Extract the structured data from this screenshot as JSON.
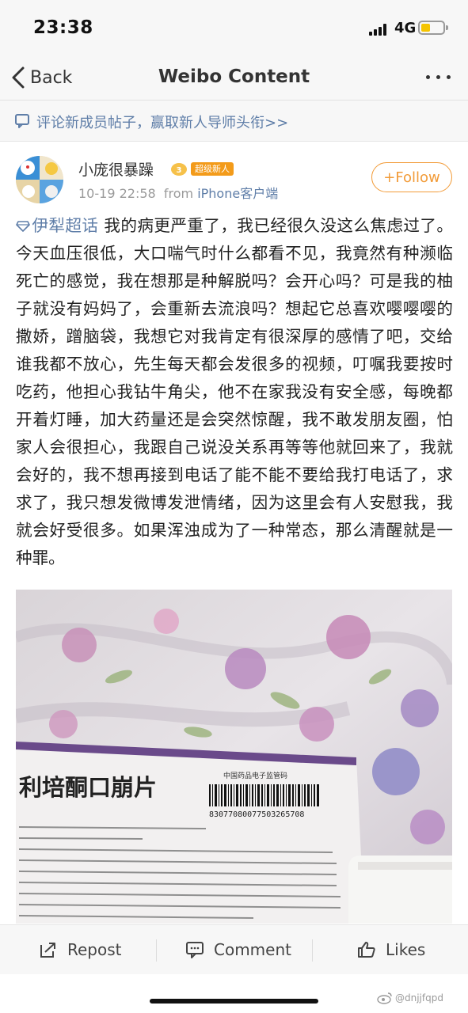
{
  "status_bar": {
    "time": "23:38",
    "network": "4G"
  },
  "nav": {
    "back_label": "Back",
    "title": "Weibo Content"
  },
  "promo": {
    "text": "评论新成员帖子，赢取新人导师头衔>>"
  },
  "post": {
    "author": "小庞很暴躁",
    "badge": "超级新人",
    "date": "10-19 22:58",
    "from_label": "from",
    "source": "iPhone客户端",
    "follow_label": "+Follow",
    "topic": "伊犁超话",
    "body": "我的病更严重了，我已经很久没这么焦虑过了。今天血压很低，大口喘气时什么都看不见，我竟然有种濒临死亡的感觉，我在想那是种解脱吗？会开心吗？可是我的柚子就没有妈妈了，会重新去流浪吗？想起它总喜欢嘤嘤嘤的撒娇，蹭脑袋，我想它对我肯定有很深厚的感情了吧，交给谁我都不放心，先生每天都会发很多的视频，叮嘱我要按时吃药，他担心我钻牛角尖，他不在家我没有安全感，每晚都开着灯睡，加大药量还是会突然惊醒，我不敢发朋友圈，怕家人会很担心，我跟自己说没关系再等等他就回来了，我就会好的，我不想再接到电话了能不能不要给我打电话了，求求了，我只想发微博发泄情绪，因为这里会有人安慰我，我就会好受很多。如果浑浊成为了一种常态，那么清醒就是一种罪。"
  },
  "photo": {
    "drug_name": "利培酮口崩片",
    "regulator": "中国药品电子监管码",
    "barcode_number": "83077080077503265708"
  },
  "actions": {
    "repost": "Repost",
    "comment": "Comment",
    "likes": "Likes"
  },
  "watermark": "@dnjjfqpd",
  "colors": {
    "link": "#5f7ea8",
    "follow": "#f29b38",
    "badge": "#f39b1a",
    "battery": "#f5c400"
  }
}
